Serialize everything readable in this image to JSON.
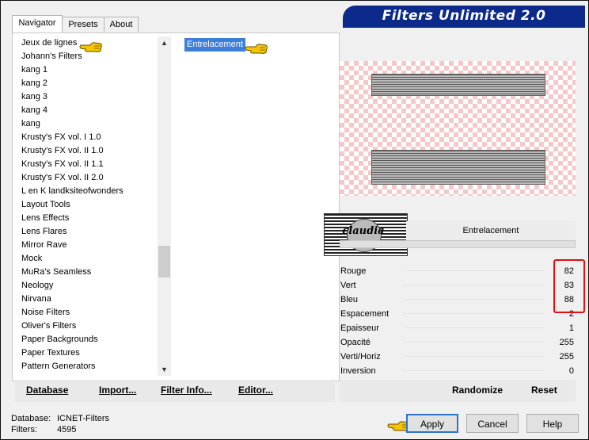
{
  "app": {
    "title": "Filters Unlimited 2.0"
  },
  "tabs": [
    "Navigator",
    "Presets",
    "About"
  ],
  "categories": [
    "Jeux de lignes",
    "Johann's Filters",
    "kang 1",
    "kang 2",
    "kang 3",
    "kang 4",
    "kang",
    "Krusty's FX vol. I 1.0",
    "Krusty's FX vol. II 1.0",
    "Krusty's FX vol. II 1.1",
    "Krusty's FX vol. II 2.0",
    "L en K landksiteofwonders",
    "Layout Tools",
    "Lens Effects",
    "Lens Flares",
    "Mirror Rave",
    "Mock",
    "MuRa's Seamless",
    "Neology",
    "Nirvana",
    "Noise Filters",
    "Oliver's Filters",
    "Paper Backgrounds",
    "Paper Textures",
    "Pattern Generators"
  ],
  "selected_filter": "Entrelacement",
  "watermark": "claudia",
  "filter_name": "Entrelacement",
  "params": [
    {
      "label": "Rouge",
      "value": "82"
    },
    {
      "label": "Vert",
      "value": "83"
    },
    {
      "label": "Bleu",
      "value": "88"
    },
    {
      "label": "Espacement",
      "value": "2"
    },
    {
      "label": "Epaisseur",
      "value": "1"
    },
    {
      "label": "Opacité",
      "value": "255"
    },
    {
      "label": "Verti/Horiz",
      "value": "255"
    },
    {
      "label": "Inversion",
      "value": "0"
    }
  ],
  "toolbar": {
    "database": "Database",
    "import": "Import...",
    "filter_info": "Filter Info...",
    "editor": "Editor..."
  },
  "actions": {
    "randomize": "Randomize",
    "reset": "Reset"
  },
  "status": {
    "database_label": "Database:",
    "database_value": "ICNET-Filters",
    "filters_label": "Filters:",
    "filters_value": "4595"
  },
  "buttons": {
    "apply": "Apply",
    "cancel": "Cancel",
    "help": "Help"
  },
  "colors": {
    "banner": "#0b2a8c",
    "selection": "#3c7fd9",
    "highlight_box": "#e21010",
    "checker": "#f5c9c9"
  },
  "icons": {
    "pointer": "pointing-hand-icon"
  }
}
